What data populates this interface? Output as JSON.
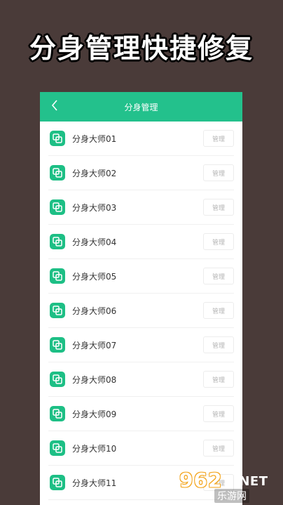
{
  "headline": "分身管理快捷修复",
  "appbar": {
    "title": "分身管理",
    "back_icon": "chevron-left-icon"
  },
  "list": {
    "items": [
      {
        "name": "分身大师01",
        "action": "管理"
      },
      {
        "name": "分身大师02",
        "action": "管理"
      },
      {
        "name": "分身大师03",
        "action": "管理"
      },
      {
        "name": "分身大师04",
        "action": "管理"
      },
      {
        "name": "分身大师05",
        "action": "管理"
      },
      {
        "name": "分身大师06",
        "action": "管理"
      },
      {
        "name": "分身大师07",
        "action": "管理"
      },
      {
        "name": "分身大师08",
        "action": "管理"
      },
      {
        "name": "分身大师09",
        "action": "管理"
      },
      {
        "name": "分身大师10",
        "action": "管理"
      },
      {
        "name": "分身大师11",
        "action": "管理"
      }
    ]
  },
  "watermark": {
    "number": "962",
    "domain": ".NET",
    "sub": "乐游网"
  },
  "colors": {
    "background": "#4a3b39",
    "accent": "#23c18c",
    "icon": "#1dbf85",
    "watermark": "#f3a51d"
  }
}
